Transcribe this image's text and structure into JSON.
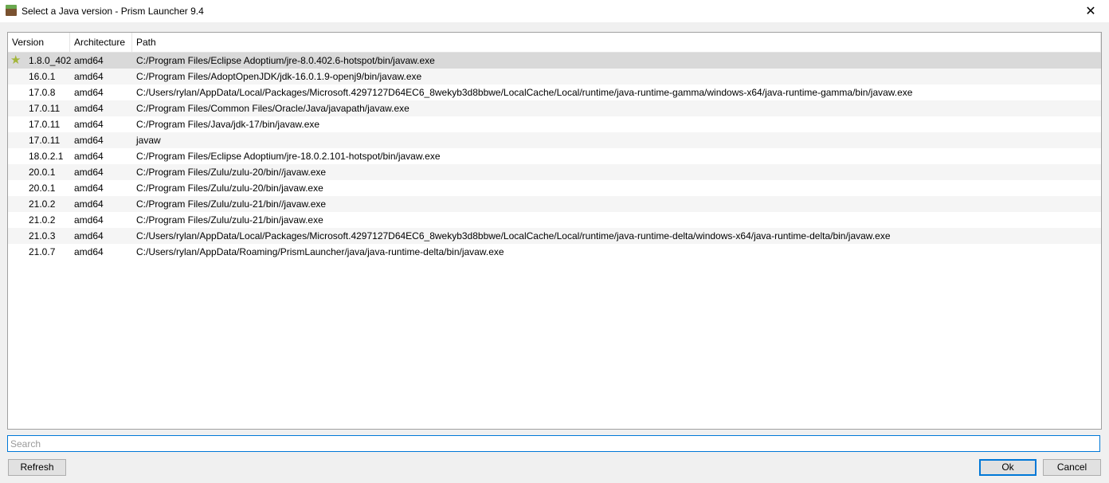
{
  "window": {
    "title": "Select a Java version - Prism Launcher 9.4",
    "close_glyph": "✕"
  },
  "table": {
    "headers": [
      "Version",
      "Architecture",
      "Path"
    ],
    "rows": [
      {
        "version": "1.8.0_402",
        "arch": "amd64",
        "path": "C:/Program Files/Eclipse Adoptium/jre-8.0.402.6-hotspot/bin/javaw.exe",
        "recommended": true
      },
      {
        "version": "16.0.1",
        "arch": "amd64",
        "path": "C:/Program Files/AdoptOpenJDK/jdk-16.0.1.9-openj9/bin/javaw.exe"
      },
      {
        "version": "17.0.8",
        "arch": "amd64",
        "path": "C:/Users/rylan/AppData/Local/Packages/Microsoft.4297127D64EC6_8wekyb3d8bbwe/LocalCache/Local/runtime/java-runtime-gamma/windows-x64/java-runtime-gamma/bin/javaw.exe"
      },
      {
        "version": "17.0.11",
        "arch": "amd64",
        "path": "C:/Program Files/Common Files/Oracle/Java/javapath/javaw.exe"
      },
      {
        "version": "17.0.11",
        "arch": "amd64",
        "path": "C:/Program Files/Java/jdk-17/bin/javaw.exe"
      },
      {
        "version": "17.0.11",
        "arch": "amd64",
        "path": "javaw"
      },
      {
        "version": "18.0.2.1",
        "arch": "amd64",
        "path": "C:/Program Files/Eclipse Adoptium/jre-18.0.2.101-hotspot/bin/javaw.exe"
      },
      {
        "version": "20.0.1",
        "arch": "amd64",
        "path": "C:/Program Files/Zulu/zulu-20/bin//javaw.exe"
      },
      {
        "version": "20.0.1",
        "arch": "amd64",
        "path": "C:/Program Files/Zulu/zulu-20/bin/javaw.exe"
      },
      {
        "version": "21.0.2",
        "arch": "amd64",
        "path": "C:/Program Files/Zulu/zulu-21/bin//javaw.exe"
      },
      {
        "version": "21.0.2",
        "arch": "amd64",
        "path": "C:/Program Files/Zulu/zulu-21/bin/javaw.exe"
      },
      {
        "version": "21.0.3",
        "arch": "amd64",
        "path": "C:/Users/rylan/AppData/Local/Packages/Microsoft.4297127D64EC6_8wekyb3d8bbwe/LocalCache/Local/runtime/java-runtime-delta/windows-x64/java-runtime-delta/bin/javaw.exe"
      },
      {
        "version": "21.0.7",
        "arch": "amd64",
        "path": "C:/Users/rylan/AppData/Roaming/PrismLauncher/java/java-runtime-delta/bin/javaw.exe"
      }
    ]
  },
  "search": {
    "placeholder": "Search",
    "value": ""
  },
  "buttons": {
    "refresh": "Refresh",
    "ok": "Ok",
    "cancel": "Cancel"
  },
  "colors": {
    "accent": "#0078d7",
    "selected_row": "#d9d9d9"
  }
}
